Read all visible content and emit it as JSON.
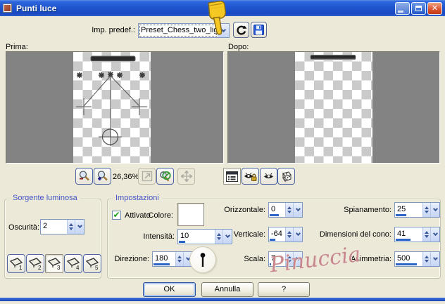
{
  "window": {
    "title": "Punti luce"
  },
  "preset": {
    "label": "Imp. predef.:",
    "value": "Preset_Chess_two_lights"
  },
  "previews": {
    "before_label": "Prima:",
    "after_label": "Dopo:"
  },
  "zoom_bar": {
    "level": "26,36%"
  },
  "light_source": {
    "title": "Sorgente luminosa",
    "darkness_label": "Oscurità:",
    "darkness_value": "2",
    "buttons": [
      "1",
      "2",
      "3",
      "4",
      "5"
    ],
    "selected_index": 2
  },
  "settings": {
    "title": "Impostazioni",
    "enabled_label": "Attivato",
    "enabled_checked": true,
    "color_label": "Colore:",
    "color_value": "#FFFFFF",
    "fields": {
      "intensity": {
        "label": "Intensità:",
        "value": "10",
        "meter": 18
      },
      "direction": {
        "label": "Direzione:",
        "value": "180",
        "meter": 72
      },
      "horizontal": {
        "label": "Orizzontale:",
        "value": "0",
        "meter": 58
      },
      "vertical": {
        "label": "Verticale:",
        "value": "-64",
        "meter": 35
      },
      "scale": {
        "label": "Scala:",
        "value": "7",
        "meter": 10
      },
      "smoothing": {
        "label": "Spianamento:",
        "value": "25",
        "meter": 38
      },
      "cone_size": {
        "label": "Dimensioni del cono:",
        "value": "41",
        "meter": 55
      },
      "asymmetry": {
        "label": "Asimmetria:",
        "value": "500",
        "meter": 78
      }
    }
  },
  "watermark": {
    "text": "Pinuccia",
    "color": "#C9888D"
  },
  "footer": {
    "ok": "OK",
    "cancel": "Annulla",
    "help": "?"
  },
  "colors": {
    "titlebar_blue": "#1E55CE",
    "dialog_bg": "#ECE9D8",
    "group_title_blue": "#4356C6",
    "meter_blue": "#2C64C8",
    "preview_bg": "#838383",
    "checker_gray": "#CACACA",
    "close_red": "#D9512C",
    "check_green": "#1DA11D"
  }
}
